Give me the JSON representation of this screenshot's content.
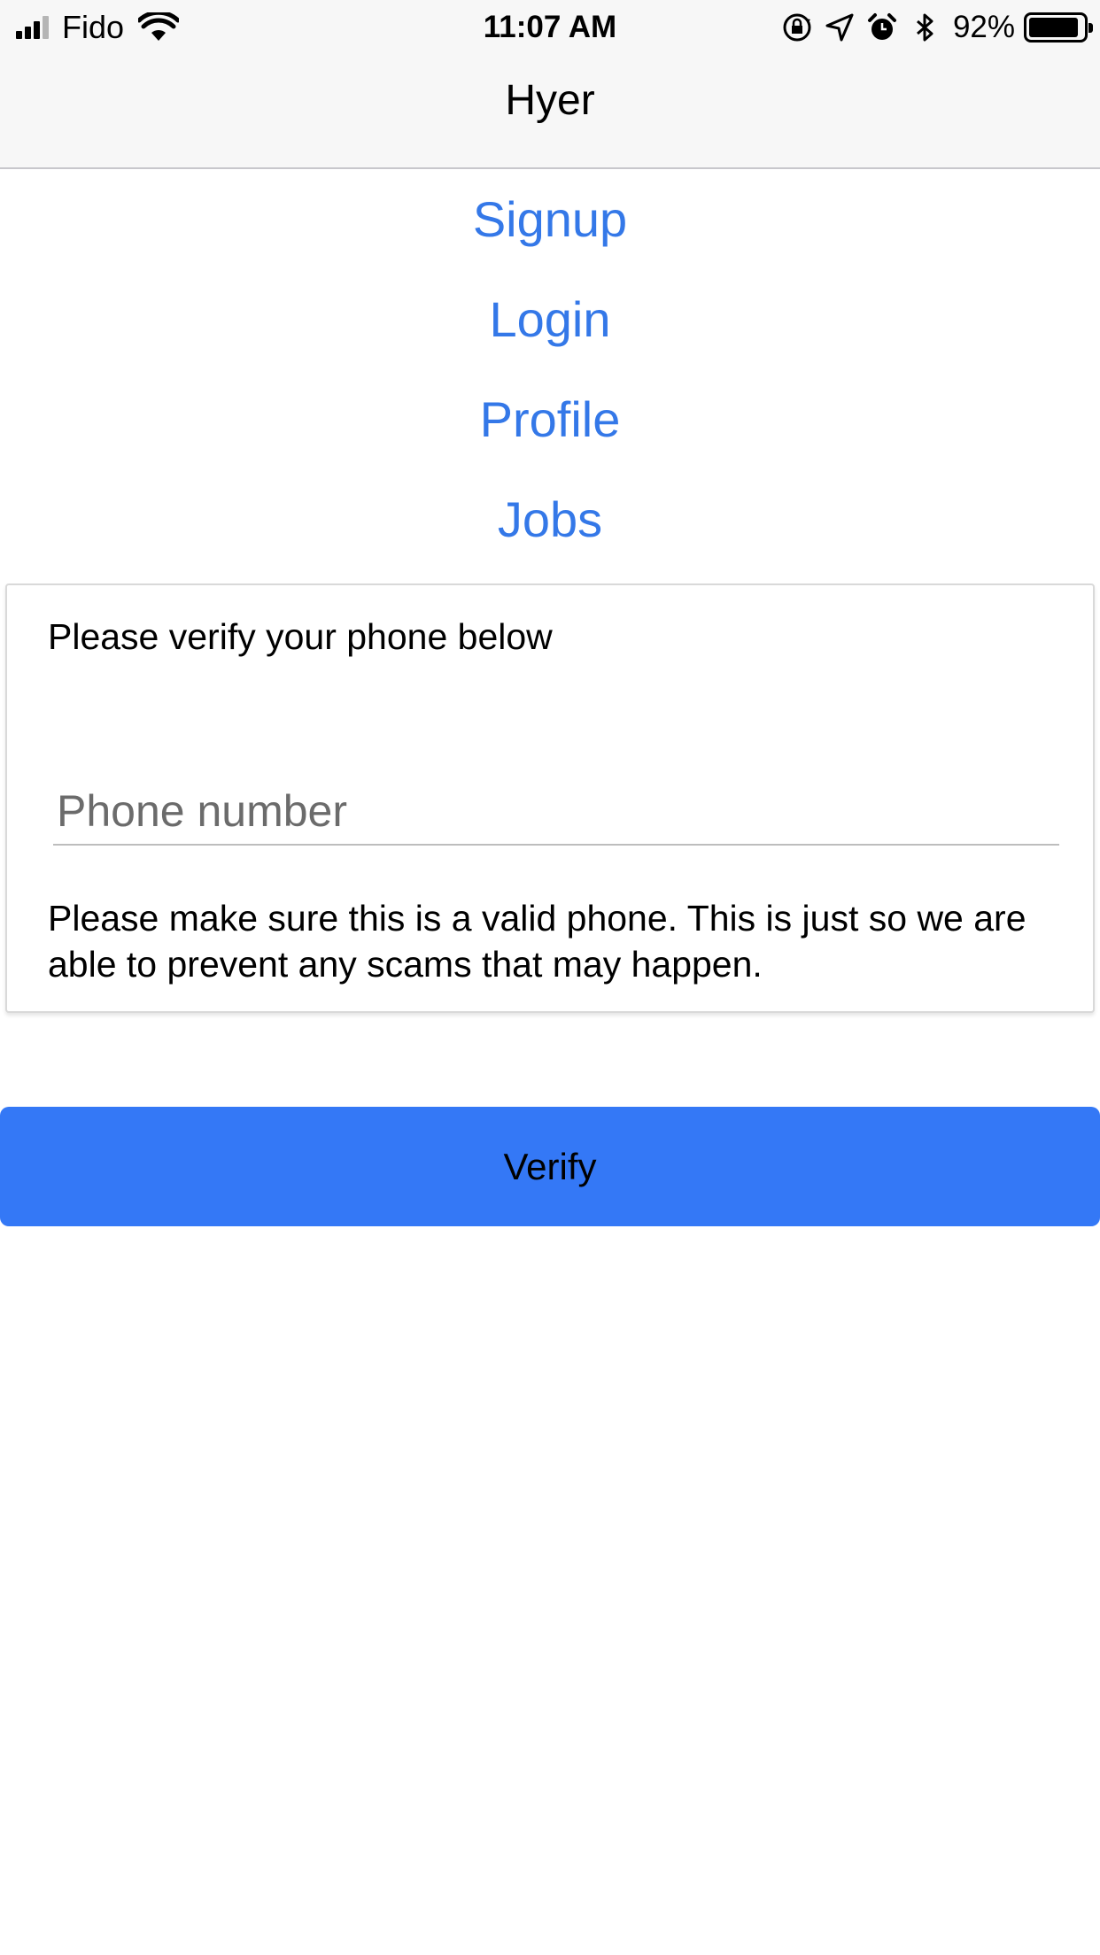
{
  "status_bar": {
    "carrier": "Fido",
    "time": "11:07 AM",
    "battery_percent": "92%",
    "battery_level": 0.92,
    "icons": [
      "signal-icon",
      "wifi-icon",
      "orientation-lock-icon",
      "location-icon",
      "alarm-icon",
      "bluetooth-icon",
      "battery-icon"
    ]
  },
  "header": {
    "title": "Hyer"
  },
  "menu": {
    "items": [
      {
        "label": "Signup"
      },
      {
        "label": "Login"
      },
      {
        "label": "Profile"
      },
      {
        "label": "Jobs"
      }
    ]
  },
  "verify_card": {
    "prompt": "Please verify your phone below",
    "phone_placeholder": "Phone number",
    "phone_value": "",
    "note": "Please make sure this is a valid phone. This is just so we are able to prevent any scams that may happen."
  },
  "actions": {
    "verify_label": "Verify"
  },
  "colors": {
    "link": "#3478e8",
    "button": "#3478f6",
    "bar_background": "#f7f7f7"
  }
}
